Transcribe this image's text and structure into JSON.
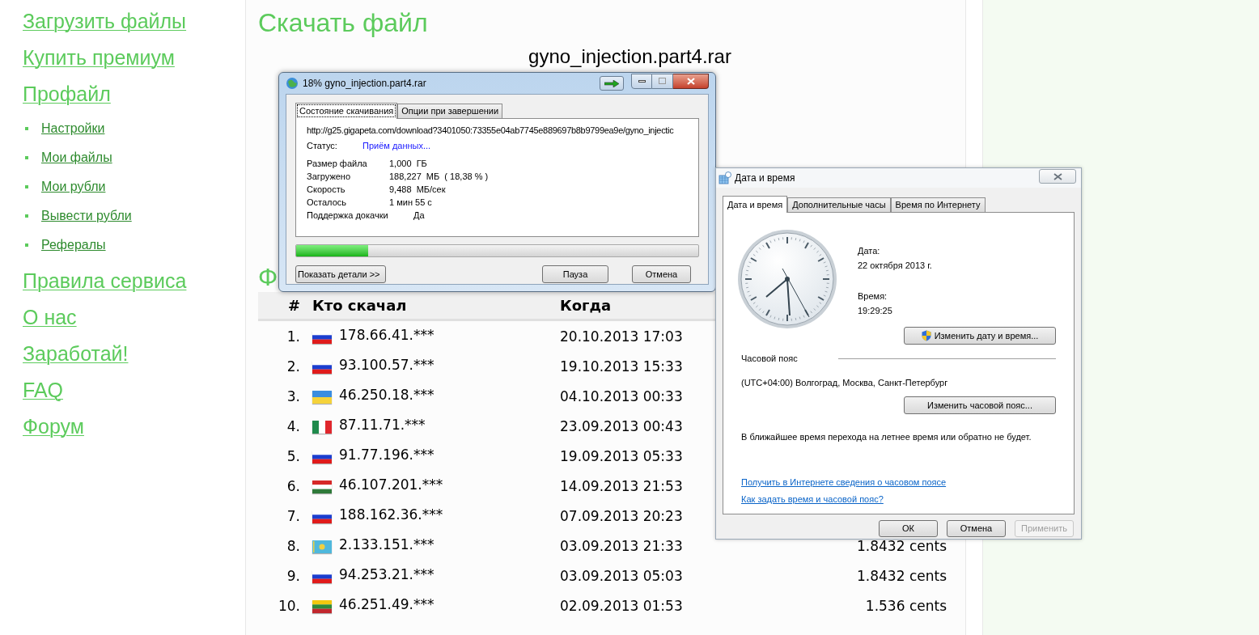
{
  "sidebar": {
    "items": [
      {
        "label": "Загрузить файлы"
      },
      {
        "label": "Купить премиум"
      },
      {
        "label": "Профайл",
        "children": [
          {
            "label": "Настройки"
          },
          {
            "label": "Мои файлы"
          },
          {
            "label": "Мои рубли"
          },
          {
            "label": "Вывести рубли"
          },
          {
            "label": "Рефералы"
          }
        ]
      },
      {
        "label": "Правила сервиса"
      },
      {
        "label": "О нас"
      },
      {
        "label": "Заработай!"
      },
      {
        "label": "FAQ"
      },
      {
        "label": "Форум"
      }
    ]
  },
  "main": {
    "title": "Скачать файл",
    "file_name": "gyno_injection.part4.rar",
    "section_heading": "Ф",
    "table": {
      "columns": [
        "#",
        "Кто скачал",
        "Когда"
      ],
      "rows": [
        {
          "number": "1.",
          "flag": {
            "kind": "ru"
          },
          "ip": "178.66.41.***",
          "date": "20.10.2013 17:03"
        },
        {
          "number": "2.",
          "flag": {
            "kind": "ru"
          },
          "ip": "93.100.57.***",
          "date": "19.10.2013 15:33"
        },
        {
          "number": "3.",
          "flag": {
            "kind": "ua"
          },
          "ip": "46.250.18.***",
          "date": "04.10.2013 00:33"
        },
        {
          "number": "4.",
          "flag": {
            "kind": "it"
          },
          "ip": "87.11.71.***",
          "date": "23.09.2013 00:43"
        },
        {
          "number": "5.",
          "flag": {
            "kind": "ru"
          },
          "ip": "91.77.196.***",
          "date": "19.09.2013 05:33"
        },
        {
          "number": "6.",
          "flag": {
            "kind": "hu"
          },
          "ip": "46.107.201.***",
          "date": "14.09.2013 21:53"
        },
        {
          "number": "7.",
          "flag": {
            "kind": "ru"
          },
          "ip": "188.162.36.***",
          "date": "07.09.2013 20:23"
        },
        {
          "number": "8.",
          "flag": {
            "kind": "kz"
          },
          "ip": "2.133.151.***",
          "date": "03.09.2013 21:33",
          "amount": "1.8432 cents"
        },
        {
          "number": "9.",
          "flag": {
            "kind": "ru"
          },
          "ip": "94.253.21.***",
          "date": "03.09.2013 05:03",
          "amount": "1.8432 cents"
        },
        {
          "number": "10.",
          "flag": {
            "kind": "lt"
          },
          "ip": "46.251.49.***",
          "date": "02.09.2013 01:53",
          "amount": "1.536 cents"
        }
      ]
    }
  },
  "download_dialog": {
    "title": "18% gyno_injection.part4.rar",
    "tabs": [
      {
        "label": "Состояние скачивания",
        "selected": true
      },
      {
        "label": "Опции при завершении",
        "selected": false
      }
    ],
    "url": "http://g25.gigapeta.com/download?3401050:73355e04ab7745e889697b8b9799ea9e/gyno_injectic",
    "status_label": "Статус:",
    "status_value": "Приём данных...",
    "details": [
      {
        "label": "Размер файла",
        "value": "1,000  ГБ"
      },
      {
        "label": "Загружено",
        "value": "188,227  МБ  ( 18,38 % )"
      },
      {
        "label": "Скорость",
        "value": "9,488  МБ/сек"
      },
      {
        "label": "Осталось",
        "value": "1 мин 55 с"
      },
      {
        "label": "Поддержка докачки",
        "value": "Да"
      }
    ],
    "progress": {
      "level": 0.18
    },
    "buttons": [
      "Показать детали >>",
      "Пауза",
      "Отмена"
    ]
  },
  "datetime_dialog": {
    "title": "Дата и время",
    "tabs": [
      {
        "label": "Дата и время",
        "selected": true
      },
      {
        "label": "Дополнительные часы",
        "selected": false
      },
      {
        "label": "Время по Интернету",
        "selected": false
      }
    ],
    "date_label": "Дата:",
    "date_value": "22 октября 2013 г.",
    "time_label": "Время:",
    "time_value": "19:29:25",
    "change_datetime_button": "Изменить дату и время...",
    "timezone_label": "Часовой пояс",
    "timezone_value": "(UTC+04:00) Волгоград, Москва, Санкт-Петербург",
    "change_timezone_button": "Изменить часовой пояс...",
    "dst_note": "В ближайшее время перехода на летнее время или обратно не будет.",
    "links": [
      "Получить в Интернете сведения о часовом поясе",
      "Как задать время и часовой пояс?"
    ],
    "buttons": [
      {
        "label": "ОК",
        "disabled": false
      },
      {
        "label": "Отмена",
        "disabled": false
      },
      {
        "label": "Применить",
        "disabled": true
      }
    ]
  }
}
